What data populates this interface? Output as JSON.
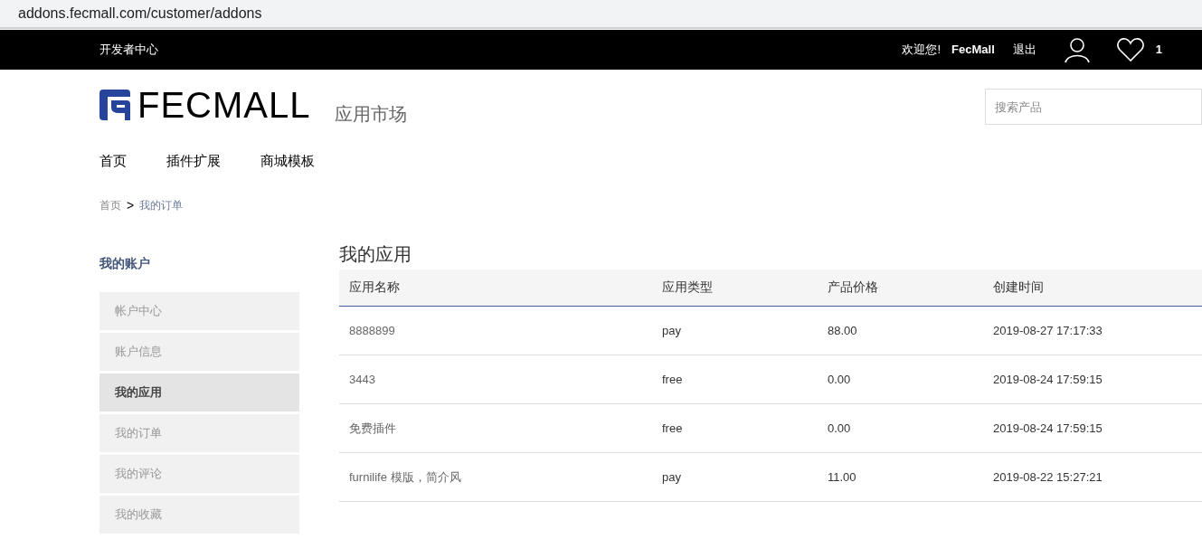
{
  "browser": {
    "url": "addons.fecmall.com/customer/addons"
  },
  "top_bar": {
    "left_link": "开发者中心",
    "welcome": "欢迎您!",
    "username": "FecMall",
    "logout": "退出",
    "wishlist_count": "1"
  },
  "header": {
    "logo_text": "FECMALL",
    "subtitle": "应用市场",
    "search": {
      "placeholder": "搜索产品"
    }
  },
  "nav": [
    "首页",
    "插件扩展",
    "商城模板"
  ],
  "breadcrumb": {
    "items": [
      "首页",
      "我的订单"
    ],
    "separator": ">"
  },
  "sidebar": {
    "title": "我的账户",
    "items": [
      {
        "label": "帐户中心",
        "selected": false
      },
      {
        "label": "账户信息",
        "selected": false
      },
      {
        "label": "我的应用",
        "selected": true
      },
      {
        "label": "我的订单",
        "selected": false
      },
      {
        "label": "我的评论",
        "selected": false
      },
      {
        "label": "我的收藏",
        "selected": false
      }
    ]
  },
  "main": {
    "title": "我的应用",
    "table": {
      "columns": [
        "应用名称",
        "应用类型",
        "产品价格",
        "创建时间"
      ],
      "rows": [
        [
          "8888899",
          "pay",
          "88.00",
          "2019-08-27 17:17:33"
        ],
        [
          "3443",
          "free",
          "0.00",
          "2019-08-24 17:59:15"
        ],
        [
          "免费插件",
          "free",
          "0.00",
          "2019-08-24 17:59:15"
        ],
        [
          "furnilife 模版，简介风",
          "pay",
          "11.00",
          "2019-08-22 15:27:21"
        ]
      ]
    }
  }
}
